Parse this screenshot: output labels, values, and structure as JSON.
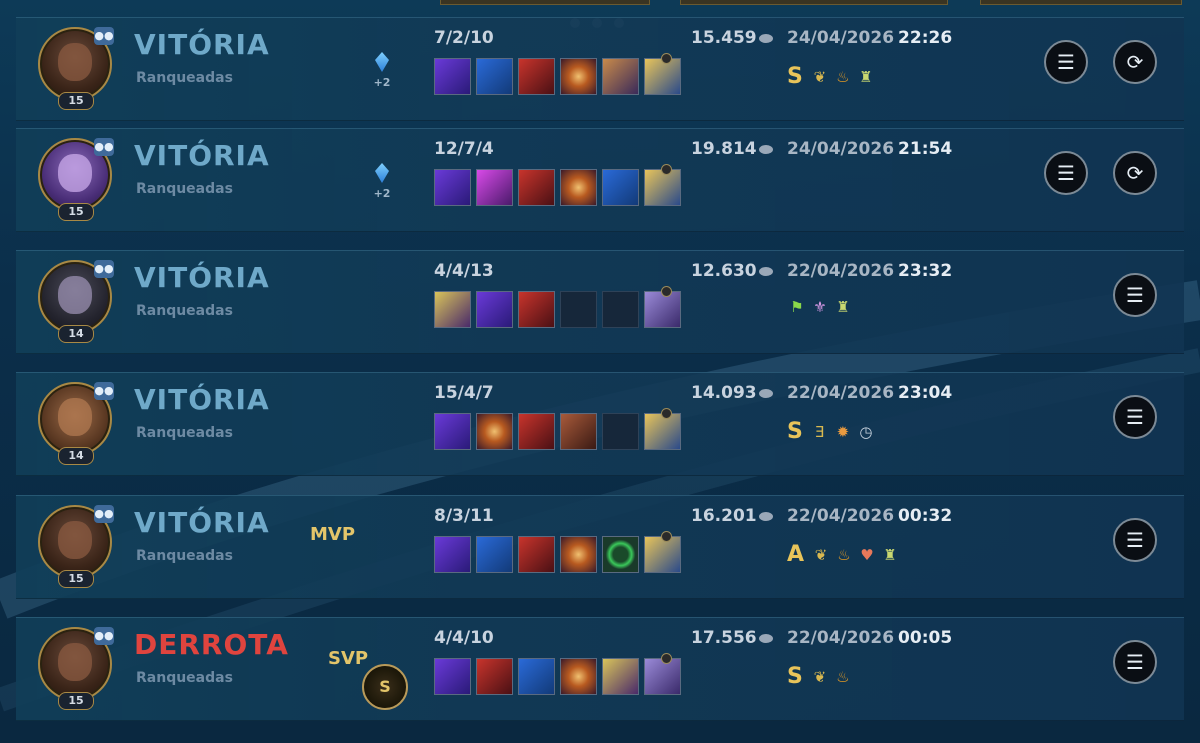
{
  "matches": [
    {
      "result": "VITÓRIA",
      "queue": "Ranqueadas",
      "level": "15",
      "avatar_style": "red-helmet",
      "gem_bonus": "+2",
      "badge": "",
      "kda": "7/2/10",
      "items": [
        "purple-relic",
        "blue-trident",
        "red-hat",
        "orange-orb",
        "tome",
        "gold-hammer"
      ],
      "gold": "15.459",
      "date": "24/04/2026",
      "time": "22:26",
      "grade": "S",
      "honors": [
        "leaf-icon",
        "flame-icon",
        "tower-icon"
      ],
      "replay": true
    },
    {
      "result": "VITÓRIA",
      "queue": "Ranqueadas",
      "level": "15",
      "avatar_style": "purple",
      "gem_bonus": "+2",
      "badge": "",
      "kda": "12/7/4",
      "items": [
        "purple-relic",
        "pink-flame",
        "red-hat",
        "orange-orb",
        "blue-staff",
        "gold-hammer"
      ],
      "gold": "19.814",
      "date": "24/04/2026",
      "time": "21:54",
      "grade": "",
      "honors": [],
      "replay": true
    },
    {
      "result": "VITÓRIA",
      "queue": "Ranqueadas",
      "level": "14",
      "avatar_style": "dark",
      "gem_bonus": "",
      "badge": "",
      "kda": "4/4/13",
      "items": [
        "crown",
        "purple-relic",
        "red-hat",
        "empty",
        "empty",
        "boots"
      ],
      "gold": "12.630",
      "date": "22/04/2026",
      "time": "23:32",
      "grade": "",
      "honors": [
        "flag-icon",
        "wing-icon",
        "tower-icon"
      ],
      "replay": false
    },
    {
      "result": "VITÓRIA",
      "queue": "Ranqueadas",
      "level": "14",
      "avatar_style": "skin",
      "gem_bonus": "",
      "badge": "",
      "kda": "15/4/7",
      "items": [
        "purple-relic",
        "orange-orb",
        "red-hat",
        "book",
        "empty",
        "gold-hammer"
      ],
      "gold": "14.093",
      "date": "22/04/2026",
      "time": "23:04",
      "grade": "S",
      "honors": [
        "triple-icon",
        "bee-icon",
        "clock-icon"
      ],
      "replay": false
    },
    {
      "result": "VITÓRIA",
      "queue": "Ranqueadas",
      "level": "15",
      "avatar_style": "red-helmet",
      "gem_bonus": "",
      "badge": "MVP",
      "kda": "8/3/11",
      "items": [
        "purple-relic",
        "blue-staff",
        "red-hat",
        "orange-orb",
        "green-ring",
        "gold-hammer"
      ],
      "gold": "16.201",
      "date": "22/04/2026",
      "time": "00:32",
      "grade": "A",
      "honors": [
        "leaf-icon",
        "flame-icon",
        "heart-icon",
        "tower-icon"
      ],
      "replay": false
    },
    {
      "result": "DERROTA",
      "queue": "Ranqueadas",
      "level": "15",
      "avatar_style": "red-helmet",
      "gem_bonus": "",
      "badge": "SVP",
      "svp_emblem": "S",
      "kda": "4/4/10",
      "items": [
        "purple-relic",
        "red-hat",
        "blue-staff",
        "orange-orb",
        "crown",
        "boots"
      ],
      "gold": "17.556",
      "date": "22/04/2026",
      "time": "00:05",
      "grade": "S",
      "honors": [
        "leaf-icon",
        "flame-icon"
      ],
      "replay": false
    }
  ],
  "icons": {
    "details": "list-icon",
    "replay": "replay-icon",
    "party": "party-icon",
    "gold": "gold-coin-icon"
  },
  "colors": {
    "win": "#6fa9c9",
    "loss": "#e0443e",
    "grade": "#e8c45a",
    "badge": "#e3c56a"
  }
}
